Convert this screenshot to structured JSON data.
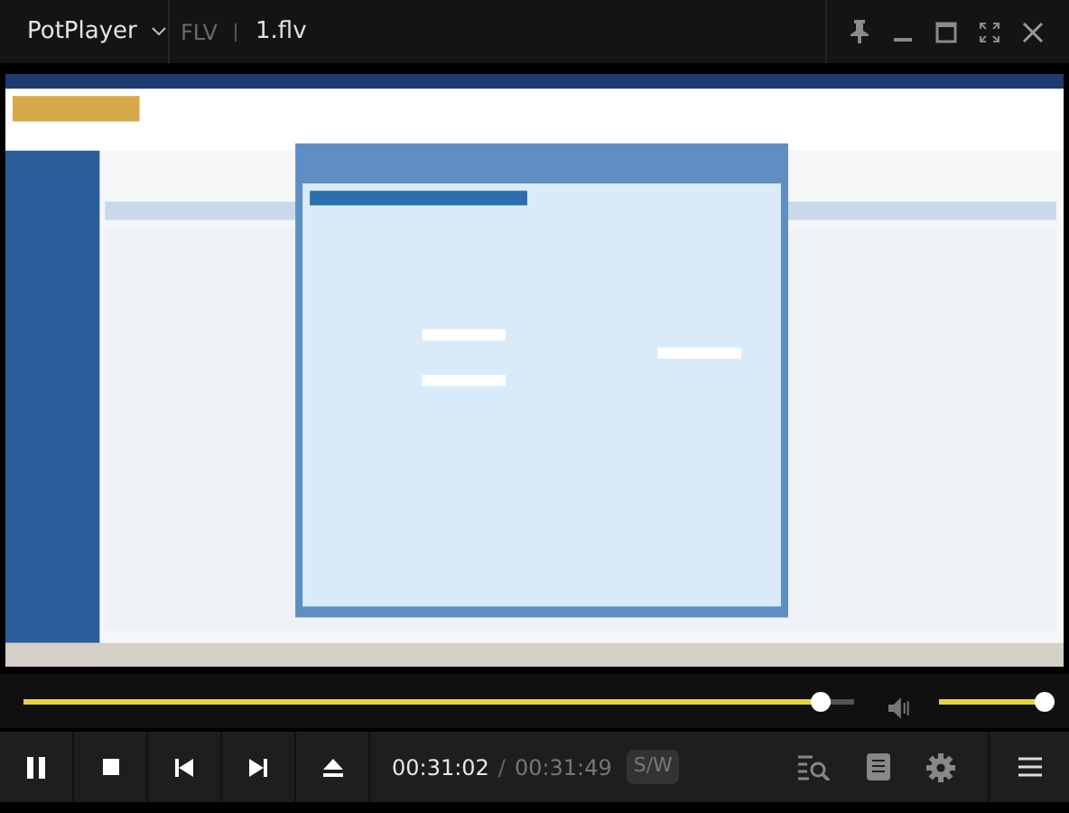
{
  "title_bar": {
    "app_name": "PotPlayer",
    "format": "FLV",
    "file_name": "1.flv"
  },
  "seek_bar": {
    "level": 0.96
  },
  "volume": {
    "level": 1
  },
  "controls": {
    "current_time": "00:31:02",
    "separator": "/",
    "total_time": "00:31:49",
    "decoder": "S/W"
  }
}
